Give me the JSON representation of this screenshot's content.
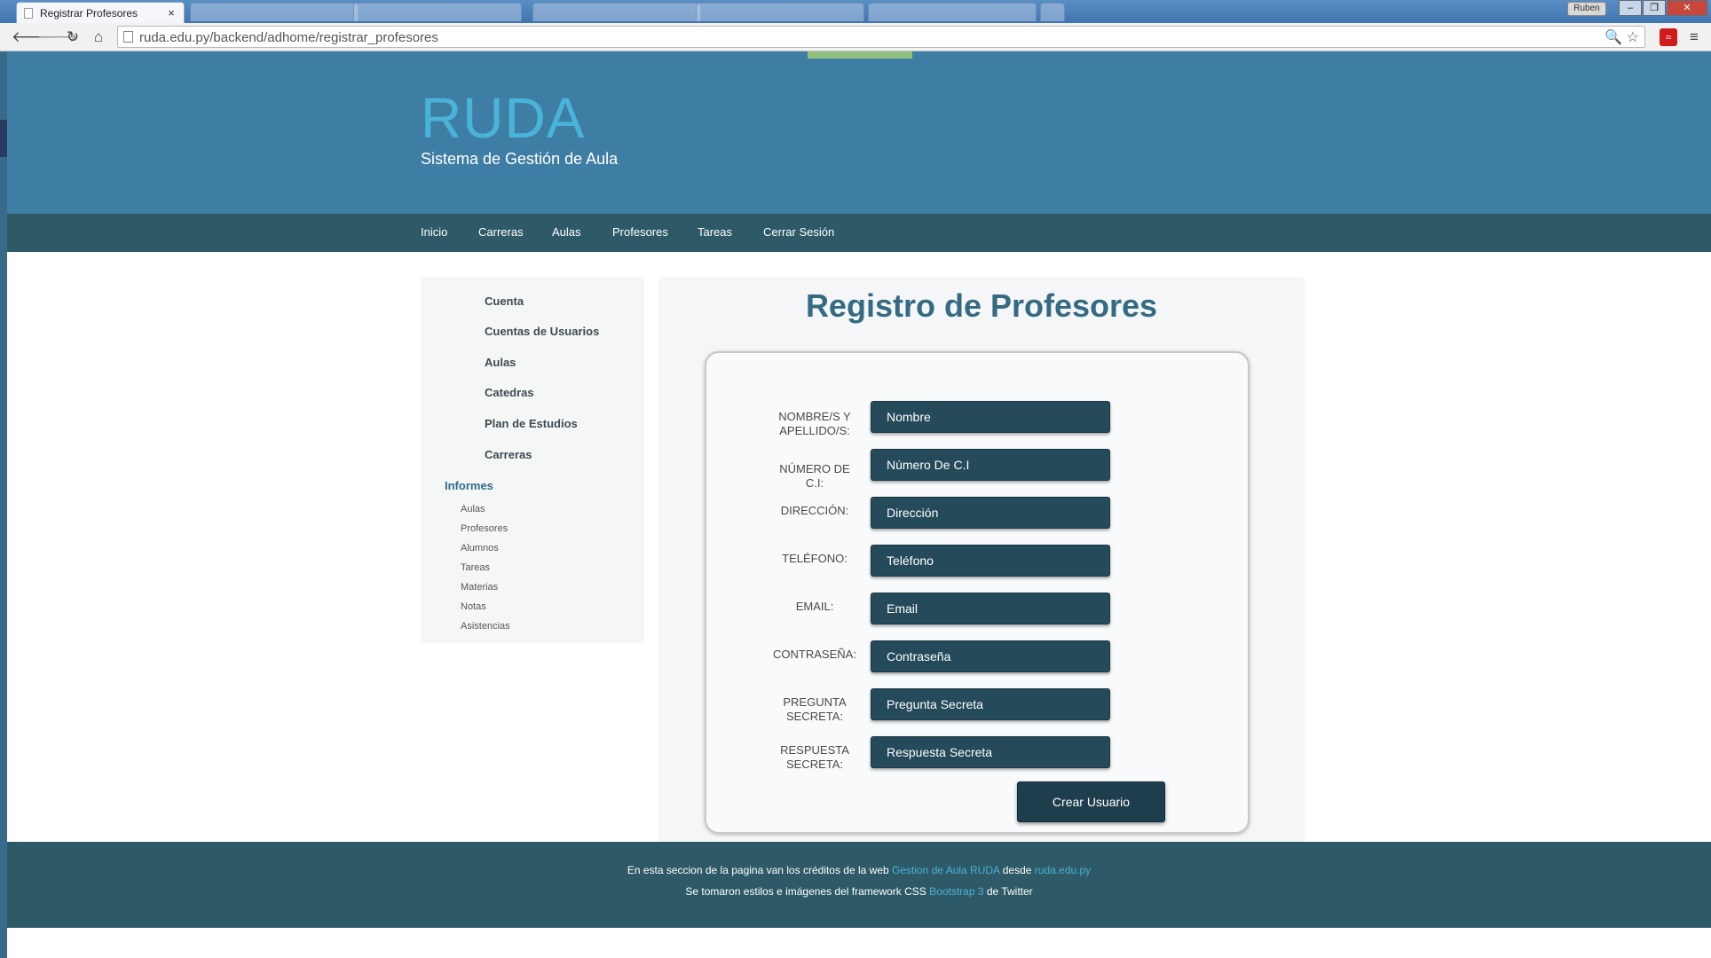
{
  "browser": {
    "tab_title": "Registrar Profesores",
    "tab_close": "×",
    "profile": "Ruben",
    "window_buttons": [
      "–",
      "❐",
      "✕"
    ],
    "url_host": "ruda.edu.py",
    "url": "ruda.edu.py/backend/adhome/registrar_profesores",
    "back": "🡐",
    "forward": "🡒",
    "reload": "↻",
    "home": "⌂",
    "omni_icons": "🔍 ☆",
    "ext": "≈",
    "menu": "≡"
  },
  "header": {
    "brand": "RUDA",
    "tagline": "Sistema de Gestión de Aula"
  },
  "nav": [
    "Inicio",
    "Carreras",
    "Aulas",
    "Profesores",
    "Tareas",
    "Cerrar Sesión"
  ],
  "sidebar": {
    "items": [
      "Cuenta",
      "Cuentas de Usuarios",
      "Aulas",
      "Catedras",
      "Plan de Estudios",
      "Carreras"
    ],
    "heading": "Informes",
    "subitems": [
      "Aulas",
      "Profesores",
      "Alumnos",
      "Tareas",
      "Materias",
      "Notas",
      "Asistencias"
    ]
  },
  "form": {
    "title": "Registro de Profesores",
    "fields": [
      {
        "label": "Nombre/s Y Apellido/s:",
        "placeholder": "Nombre"
      },
      {
        "label": "Número de C.I:",
        "placeholder": "Número De C.I"
      },
      {
        "label": "Dirección:",
        "placeholder": "Dirección"
      },
      {
        "label": "Teléfono:",
        "placeholder": "Teléfono"
      },
      {
        "label": "Email:",
        "placeholder": "Email"
      },
      {
        "label": "Contraseña:",
        "placeholder": "Contraseña"
      },
      {
        "label": "Pregunta Secreta:",
        "placeholder": "Pregunta Secreta"
      },
      {
        "label": "Respuesta Secreta:",
        "placeholder": "Respuesta Secreta"
      }
    ],
    "submit": "Crear Usuario"
  },
  "footer": {
    "line1_a": "En esta seccion de la pagina van los créditos de la web ",
    "line1_link1": "Gestion de Aula RUDA",
    "line1_b": " desde ",
    "line1_link2": "ruda.edu.py",
    "line2_a": "Se tomaron estilos e imágenes del framework CSS ",
    "line2_link": "Bootstrap 3",
    "line2_b": " de Twitter"
  }
}
